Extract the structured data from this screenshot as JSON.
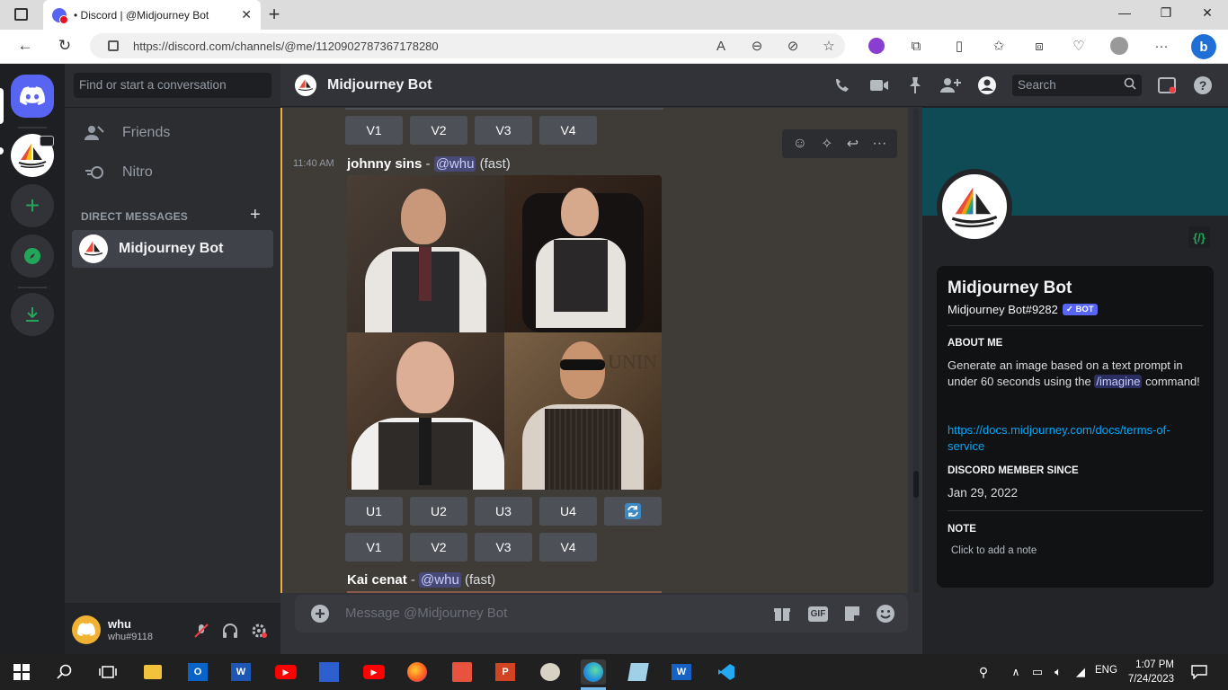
{
  "browser": {
    "tab_title": "• Discord | @Midjourney Bot",
    "url": "https://discord.com/channels/@me/1120902787367178280"
  },
  "sidebar": {
    "search_placeholder": "Find or start a conversation",
    "friends_label": "Friends",
    "nitro_label": "Nitro",
    "dm_header": "DIRECT MESSAGES",
    "dm_item": "Midjourney Bot"
  },
  "user": {
    "name": "whu",
    "tag": "whu#9118"
  },
  "channel": {
    "title": "Midjourney Bot",
    "search_placeholder": "Search"
  },
  "messages": {
    "top_buttons": [
      "V1",
      "V2",
      "V3",
      "V4"
    ],
    "timestamp": "11:40 AM",
    "author": "johnny sins",
    "separator": " - ",
    "mention": "@whu",
    "mode": " (fast)",
    "u_buttons": [
      "U1",
      "U2",
      "U3",
      "U4"
    ],
    "v_buttons": [
      "V1",
      "V2",
      "V3",
      "V4"
    ],
    "next_author": "Kai cenat",
    "next_mention": "@whu",
    "next_mode": " (fast)"
  },
  "composer": {
    "placeholder": "Message @Midjourney Bot"
  },
  "profile": {
    "name": "Midjourney Bot",
    "tag": "Midjourney Bot#9282",
    "badge": "✓ BOT",
    "about_header": "ABOUT ME",
    "about_text_1": "Generate an image based on a text prompt in under 60 seconds using the ",
    "about_cmd": "/imagine",
    "about_text_2": " command!",
    "link": "https://docs.midjourney.com/docs/terms-of-service",
    "member_header": "DISCORD MEMBER SINCE",
    "member_since": "Jan 29, 2022",
    "note_header": "NOTE",
    "note_placeholder": "Click to add a note"
  },
  "taskbar": {
    "lang": "ENG",
    "time": "1:07 PM",
    "date": "7/24/2023"
  },
  "colors": {
    "blurple": "#5865f2",
    "green": "#23a55a",
    "sidebar": "#2b2d31",
    "chat": "#313338"
  }
}
